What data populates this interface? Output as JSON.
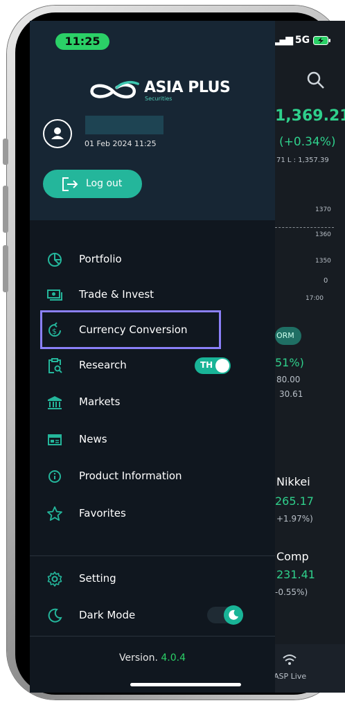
{
  "status_bar": {
    "time": "11:25",
    "network": "5G"
  },
  "brand": {
    "name": "ASIA PLUS",
    "sub": "Securities"
  },
  "user": {
    "datetime": "01 Feb 2024 11:25"
  },
  "logout_label": "Log out",
  "menu": [
    {
      "label": "Portfolio",
      "icon": "portfolio-pie-icon"
    },
    {
      "label": "Trade & Invest",
      "icon": "money-icon"
    },
    {
      "label": "Currency Conversion",
      "icon": "currency-exchange-icon"
    },
    {
      "label": "Research",
      "icon": "research-clipboard-icon"
    },
    {
      "label": "Markets",
      "icon": "bank-icon"
    },
    {
      "label": "News",
      "icon": "news-icon"
    },
    {
      "label": "Product Information",
      "icon": "info-icon"
    },
    {
      "label": "Favorites",
      "icon": "star-icon"
    }
  ],
  "research_toggle": {
    "label": "TH",
    "on": true
  },
  "settings": [
    {
      "label": "Setting",
      "icon": "gear-icon"
    },
    {
      "label": "Dark Mode",
      "icon": "moon-icon"
    }
  ],
  "version": {
    "label": "Version.",
    "number": "4.0.4"
  },
  "background": {
    "index_value": "1,369.21",
    "index_change": "(+0.34%)",
    "hl": "71   L : 1,357.39",
    "y_ticks": [
      "1370",
      "1360",
      "1350",
      "0"
    ],
    "x_tick": "17:00",
    "tag": "ORM",
    "pct": "51%)",
    "v1": "80.00",
    "v2": "30.61",
    "nikkei_name": "Nikkei",
    "nikkei_value": "265.17",
    "nikkei_change": "+1.97%)",
    "comp_name": "Comp",
    "comp_value": "231.41",
    "comp_change": "-0.55%)",
    "asp_live": "ASP Live"
  },
  "colors": {
    "accent": "#24b69b",
    "highlight": "#8b80f9",
    "green": "#2bd067"
  }
}
